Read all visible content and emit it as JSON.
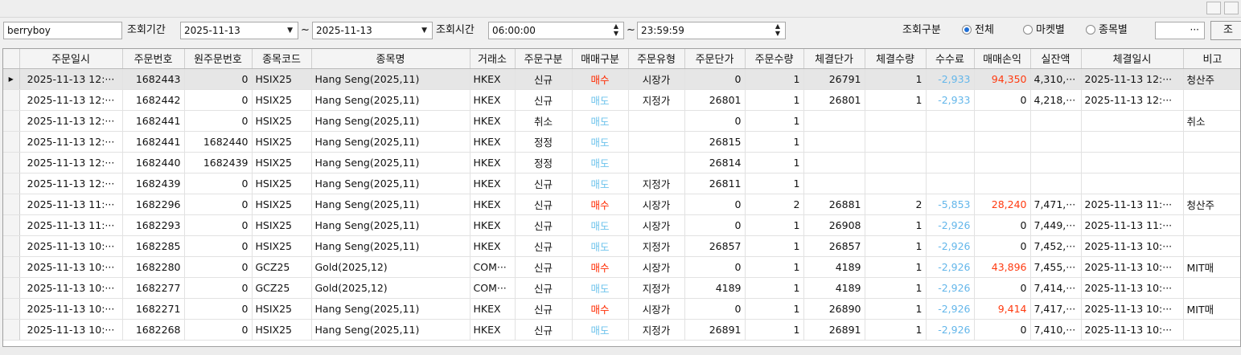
{
  "filters": {
    "user_id": "berryboy",
    "period_label": "조회기간",
    "date_from": "2025-11-13",
    "tilde": "~",
    "date_to": "2025-11-13",
    "time_label": "조회시간",
    "time_from": "06:00:00",
    "time_to": "23:59:59",
    "mode_label": "조회구분",
    "modes": [
      {
        "label": "전체",
        "selected": true
      },
      {
        "label": "마켓별",
        "selected": false
      },
      {
        "label": "종목별",
        "selected": false
      }
    ],
    "symbol_value": "",
    "browse_label": "···",
    "query_label": "조"
  },
  "icons": {
    "dropdown": "chevron-down-icon",
    "spinner": "spinner-arrows-icon",
    "current_row": "row-pointer-icon"
  },
  "colors": {
    "buy": "#ff2a00",
    "sell": "#6ec3ec",
    "fee": "#63b6ea",
    "profit": "#ff3a10",
    "selected_row": "#e6e6e6"
  },
  "grid": {
    "columns": [
      "주문일시",
      "주문번호",
      "원주문번호",
      "종목코드",
      "종목명",
      "거래소",
      "주문구분",
      "매매구분",
      "주문유형",
      "주문단가",
      "주문수량",
      "체결단가",
      "체결수량",
      "수수료",
      "매매손익",
      "실잔액",
      "체결일시",
      "비고"
    ],
    "rows": [
      {
        "selected": true,
        "cells": [
          "2025-11-13 12:···",
          "1682443",
          "0",
          "HSIX25",
          "Hang Seng(2025,11)",
          "HKEX",
          "신규",
          "매수",
          "시장가",
          "0",
          "1",
          "26791",
          "1",
          "-2,933",
          "94,350",
          "4,310,···",
          "2025-11-13 12:···",
          "청산주"
        ]
      },
      {
        "selected": false,
        "cells": [
          "2025-11-13 12:···",
          "1682442",
          "0",
          "HSIX25",
          "Hang Seng(2025,11)",
          "HKEX",
          "신규",
          "매도",
          "지정가",
          "26801",
          "1",
          "26801",
          "1",
          "-2,933",
          "0",
          "4,218,···",
          "2025-11-13 12:···",
          ""
        ]
      },
      {
        "selected": false,
        "cells": [
          "2025-11-13 12:···",
          "1682441",
          "0",
          "HSIX25",
          "Hang Seng(2025,11)",
          "HKEX",
          "취소",
          "매도",
          "",
          "0",
          "1",
          "",
          "",
          "",
          "",
          "",
          "",
          "취소"
        ]
      },
      {
        "selected": false,
        "cells": [
          "2025-11-13 12:···",
          "1682441",
          "1682440",
          "HSIX25",
          "Hang Seng(2025,11)",
          "HKEX",
          "정정",
          "매도",
          "",
          "26815",
          "1",
          "",
          "",
          "",
          "",
          "",
          "",
          ""
        ]
      },
      {
        "selected": false,
        "cells": [
          "2025-11-13 12:···",
          "1682440",
          "1682439",
          "HSIX25",
          "Hang Seng(2025,11)",
          "HKEX",
          "정정",
          "매도",
          "",
          "26814",
          "1",
          "",
          "",
          "",
          "",
          "",
          "",
          ""
        ]
      },
      {
        "selected": false,
        "cells": [
          "2025-11-13 12:···",
          "1682439",
          "0",
          "HSIX25",
          "Hang Seng(2025,11)",
          "HKEX",
          "신규",
          "매도",
          "지정가",
          "26811",
          "1",
          "",
          "",
          "",
          "",
          "",
          "",
          ""
        ]
      },
      {
        "selected": false,
        "cells": [
          "2025-11-13 11:···",
          "1682296",
          "0",
          "HSIX25",
          "Hang Seng(2025,11)",
          "HKEX",
          "신규",
          "매수",
          "시장가",
          "0",
          "2",
          "26881",
          "2",
          "-5,853",
          "28,240",
          "7,471,···",
          "2025-11-13 11:···",
          "청산주"
        ]
      },
      {
        "selected": false,
        "cells": [
          "2025-11-13 11:···",
          "1682293",
          "0",
          "HSIX25",
          "Hang Seng(2025,11)",
          "HKEX",
          "신규",
          "매도",
          "시장가",
          "0",
          "1",
          "26908",
          "1",
          "-2,926",
          "0",
          "7,449,···",
          "2025-11-13 11:···",
          ""
        ]
      },
      {
        "selected": false,
        "cells": [
          "2025-11-13 10:···",
          "1682285",
          "0",
          "HSIX25",
          "Hang Seng(2025,11)",
          "HKEX",
          "신규",
          "매도",
          "지정가",
          "26857",
          "1",
          "26857",
          "1",
          "-2,926",
          "0",
          "7,452,···",
          "2025-11-13 10:···",
          ""
        ]
      },
      {
        "selected": false,
        "cells": [
          "2025-11-13 10:···",
          "1682280",
          "0",
          "GCZ25",
          "Gold(2025,12)",
          "COM···",
          "신규",
          "매수",
          "시장가",
          "0",
          "1",
          "4189",
          "1",
          "-2,926",
          "43,896",
          "7,455,···",
          "2025-11-13 10:···",
          "MIT매"
        ]
      },
      {
        "selected": false,
        "cells": [
          "2025-11-13 10:···",
          "1682277",
          "0",
          "GCZ25",
          "Gold(2025,12)",
          "COM···",
          "신규",
          "매도",
          "지정가",
          "4189",
          "1",
          "4189",
          "1",
          "-2,926",
          "0",
          "7,414,···",
          "2025-11-13 10:···",
          ""
        ]
      },
      {
        "selected": false,
        "cells": [
          "2025-11-13 10:···",
          "1682271",
          "0",
          "HSIX25",
          "Hang Seng(2025,11)",
          "HKEX",
          "신규",
          "매수",
          "시장가",
          "0",
          "1",
          "26890",
          "1",
          "-2,926",
          "9,414",
          "7,417,···",
          "2025-11-13 10:···",
          "MIT매"
        ]
      },
      {
        "selected": false,
        "cells": [
          "2025-11-13 10:···",
          "1682268",
          "0",
          "HSIX25",
          "Hang Seng(2025,11)",
          "HKEX",
          "신규",
          "매도",
          "지정가",
          "26891",
          "1",
          "26891",
          "1",
          "-2,926",
          "0",
          "7,410,···",
          "2025-11-13 10:···",
          ""
        ]
      }
    ]
  }
}
